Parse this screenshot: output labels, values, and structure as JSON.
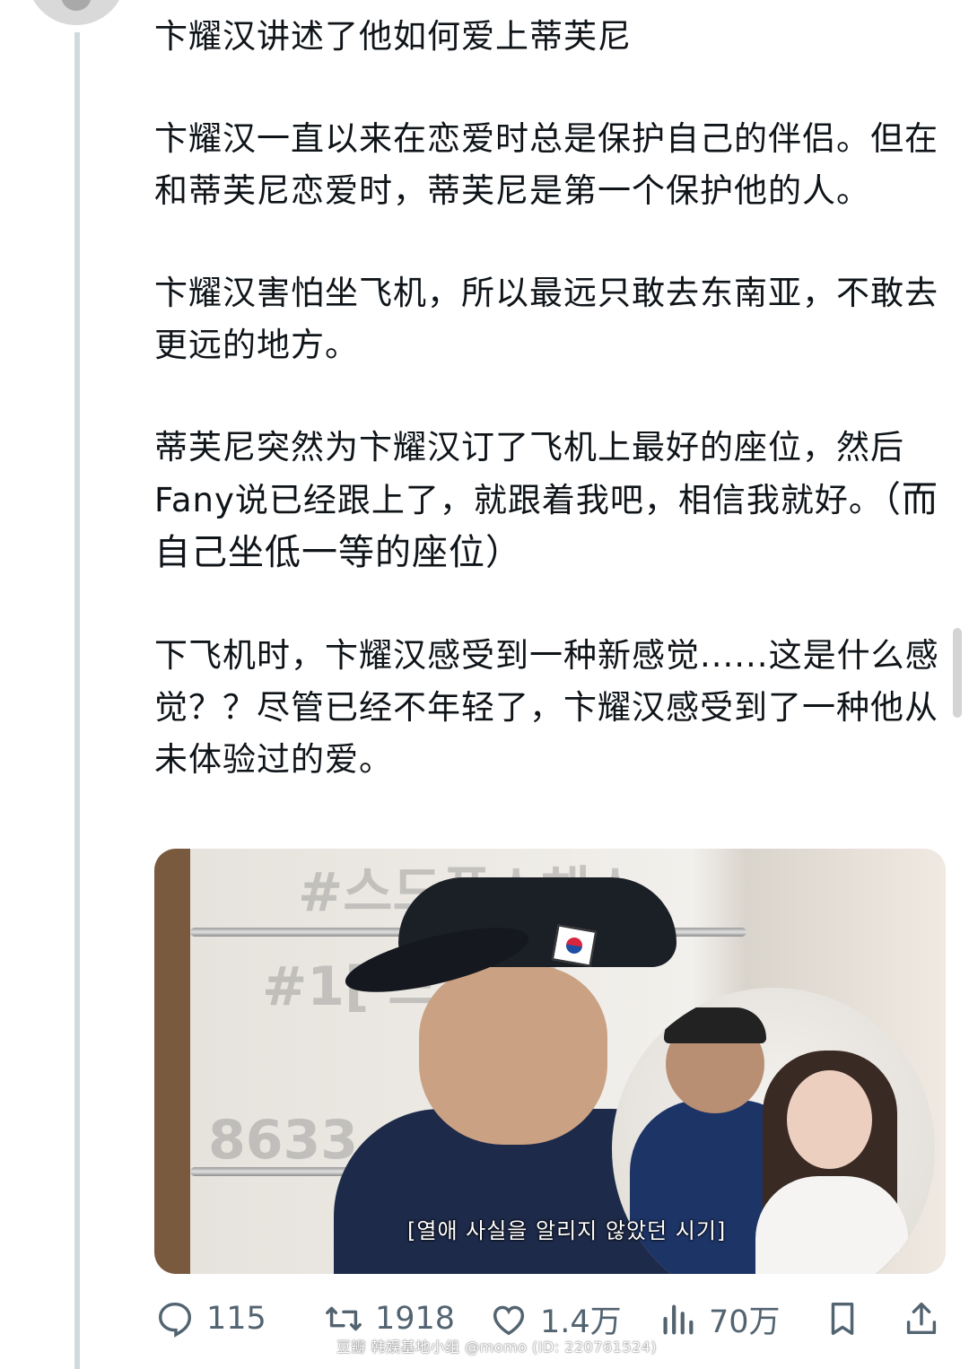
{
  "post": {
    "paragraphs": [
      "卞耀汉讲述了他如何爱上蒂芙尼",
      "卞耀汉一直以来在恋爱时总是保护自己的伴侣。但在和蒂芙尼恋爱时，蒂芙尼是第一个保护他的人。",
      "卞耀汉害怕坐飞机，所以最远只敢去东南亚，不敢去更远的地方。",
      "蒂芙尼突然为卞耀汉订了飞机上最好的座位，然后Fany说已经跟上了，就跟着我吧，相信我就好。",
      "下飞机时，卞耀汉感受到一种新感觉......这是什么感觉？？尽管已经不年轻了，卞耀汉感受到了一种他从未体验过的爱。"
    ],
    "paragraph4_suffix": "（而自己坐低一等的座位）"
  },
  "media": {
    "subtitle": "[열애 사실을 알리지 않았던 시기]",
    "bg_text_top": "#스드폰스해소",
    "bg_text_mid": "#1[ 드]배점",
    "bg_text_number": "8633"
  },
  "actions": {
    "reply_count": "115",
    "retweet_count": "1918",
    "like_count": "1.4万",
    "views_count": "70万"
  },
  "watermark": "豆瓣  韩娱基地小组 @momo (ID: 220761524)",
  "icons": [
    "reply-icon",
    "retweet-icon",
    "like-icon",
    "views-icon",
    "bookmark-icon",
    "share-icon"
  ],
  "colors": {
    "text": "#0f1419",
    "secondary": "#536471",
    "thread_line": "#cfd9de"
  }
}
